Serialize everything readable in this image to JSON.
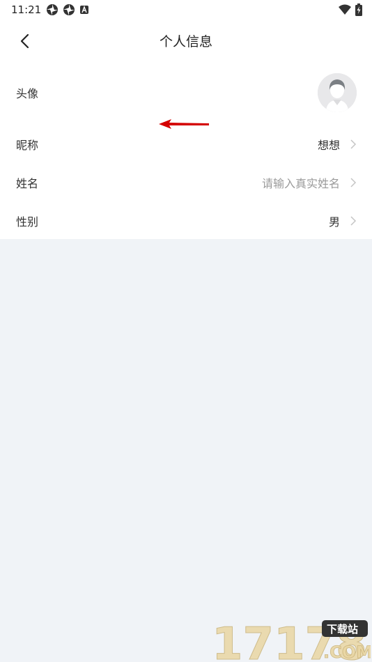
{
  "status_bar": {
    "time": "11:21",
    "left_icons": [
      "aperture-icon",
      "aperture-icon",
      "a-badge-icon"
    ],
    "right_icons": [
      "wifi-icon",
      "battery-charging-icon"
    ]
  },
  "header": {
    "title": "个人信息",
    "back_icon": "chevron-left-icon"
  },
  "profile": {
    "avatar": {
      "label": "头像",
      "icon": "default-avatar-icon"
    },
    "nickname": {
      "label": "昵称",
      "value": "想想"
    },
    "name": {
      "label": "姓名",
      "placeholder": "请输入真实姓名"
    },
    "gender": {
      "label": "性别",
      "value": "男"
    }
  },
  "annotation": {
    "icon": "red-arrow-left-icon",
    "color": "#d40000"
  },
  "watermark": {
    "text": "17178",
    "domain": ".COM",
    "badge": "下载站"
  },
  "colors": {
    "background": "#f0f3f7",
    "card": "#ffffff",
    "placeholder": "#9a9a9a",
    "chevron": "#c4c4c4"
  }
}
